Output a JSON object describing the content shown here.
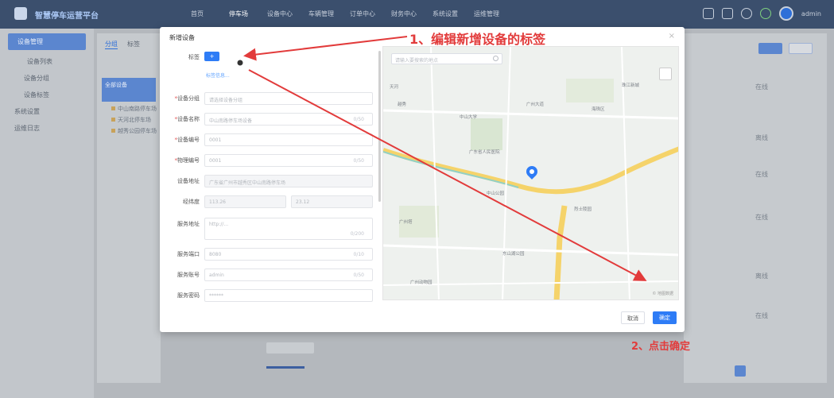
{
  "annotations": {
    "step1": "1、编辑新增设备的标签",
    "step2": "2、点击确定"
  },
  "modal": {
    "title": "新增设备",
    "close": "×",
    "tag_label": "标签",
    "tag_button": "+",
    "tag_hint": "标签信息...",
    "cancel": "取消",
    "confirm": "确定"
  },
  "form_rows": [
    {
      "label": "设备分组",
      "required": true,
      "value": "请选择设备分组",
      "counter": ""
    },
    {
      "label": "设备名称",
      "required": true,
      "value": "中山南路停车场设备",
      "counter": "0/50"
    },
    {
      "label": "设备编号",
      "required": true,
      "value": "0001",
      "counter": ""
    },
    {
      "label": "物理编号",
      "required": true,
      "value": "0001",
      "counter": "0/50"
    },
    {
      "label": "设备地址",
      "required": false,
      "value": "广东省广州市越秀区中山南路停车场",
      "counter": ""
    },
    {
      "label": "经纬度",
      "required": false,
      "value": "113.26",
      "value2": "23.12",
      "counter": ""
    },
    {
      "label": "服务地址",
      "required": false,
      "value": "http://...",
      "counter": "0/200"
    },
    {
      "label": "服务端口",
      "required": false,
      "value": "8080",
      "counter": "0/10"
    },
    {
      "label": "服务账号",
      "required": false,
      "value": "admin",
      "counter": "0/50"
    },
    {
      "label": "服务密码",
      "required": false,
      "value": "******",
      "counter": ""
    }
  ],
  "map": {
    "search_placeholder": "请输入要搜索的地点",
    "labels": [
      "天河",
      "越秀",
      "中山大学",
      "广州大道",
      "珠江新城",
      "海珠区",
      "广东省人民医院",
      "中山公园",
      "烈士陵园",
      "广州塔",
      "东山湖公园",
      "广州动物园"
    ],
    "credit": "© 地图数据"
  },
  "background": {
    "app_title": "智慧停车运营平台",
    "nav": [
      "首页",
      "停车场",
      "设备中心",
      "车辆管理",
      "订单中心",
      "财务中心",
      "系统设置",
      "运维管理"
    ],
    "username": "admin",
    "sidebar": [
      "设备管理",
      "设备列表",
      "设备分组",
      "设备标签",
      "系统设置",
      "运维日志"
    ],
    "tree_tabs": [
      "分组",
      "标签"
    ],
    "tree_nodes": [
      "全部设备",
      "中山南路停车场",
      "天河北停车场",
      "越秀公园停车场"
    ],
    "right_rows": [
      "在线",
      "离线",
      "在线",
      "在线",
      "离线",
      "在线"
    ],
    "pagination": "1"
  }
}
